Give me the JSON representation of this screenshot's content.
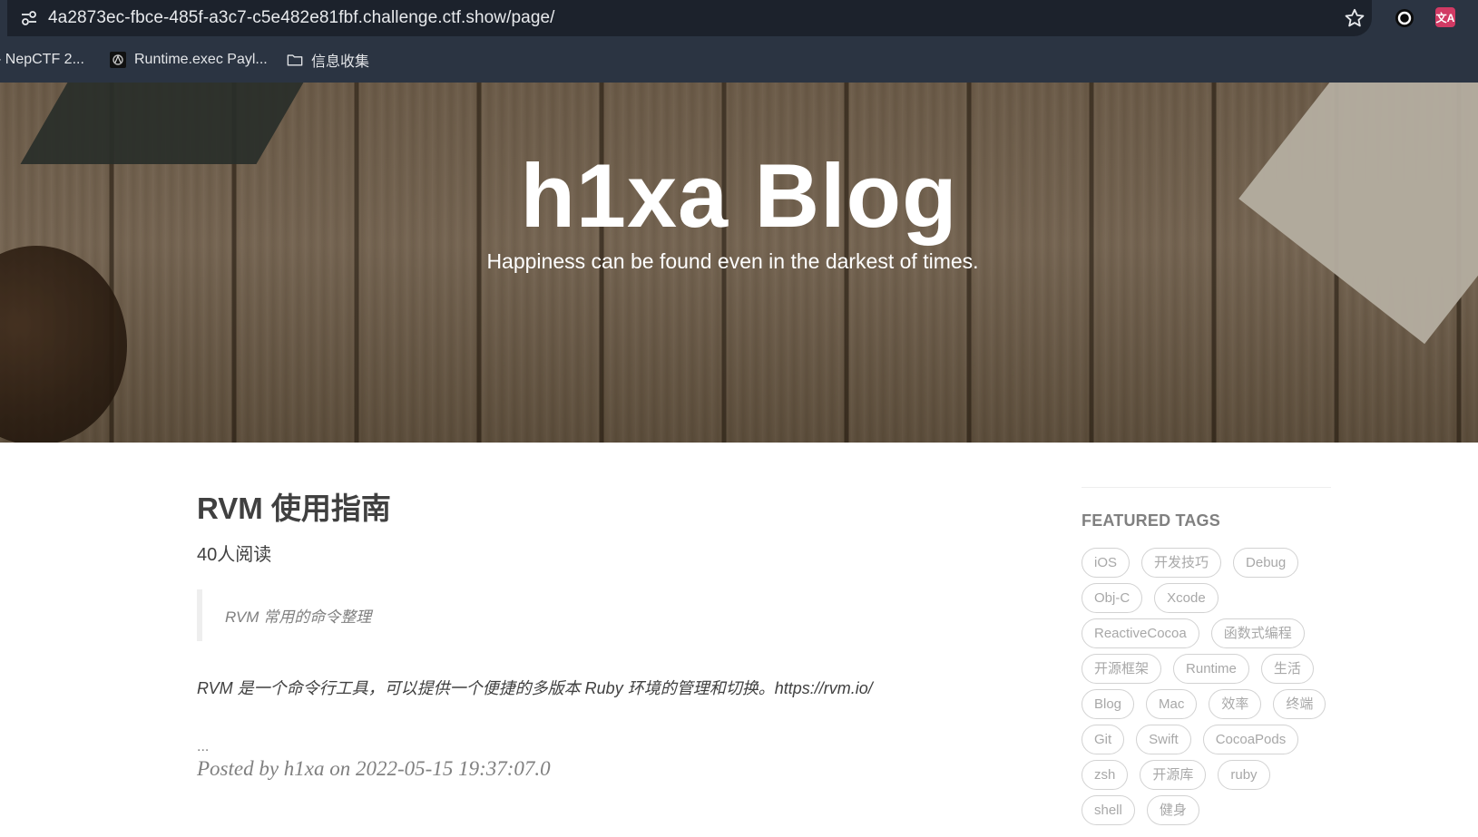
{
  "browser": {
    "url": "4a2873ec-fbce-485f-a3c7-c5e482e81fbf.challenge.ctf.show/page/",
    "icons": {
      "site_info": "tune-icon",
      "bookmark": "star-icon",
      "extension": "circle-icon",
      "translate": "translate-icon"
    },
    "translate_glyph": "文A",
    "bookmarks": [
      {
        "label": "- NepCTF 2...",
        "icon": "page-icon"
      },
      {
        "label": "Runtime.exec Payl...",
        "icon": "site-favicon"
      },
      {
        "label": "信息收集",
        "icon": "folder-icon"
      }
    ]
  },
  "hero": {
    "title": "h1xa Blog",
    "subtitle": "Happiness can be found even in the darkest of times."
  },
  "post": {
    "title": "RVM 使用指南",
    "reads": "40人阅读",
    "quote": "RVM 常用的命令整理",
    "body": "RVM 是一个命令行工具，可以提供一个便捷的多版本 Ruby 环境的管理和切换。https://rvm.io/",
    "ellipsis": "...",
    "meta": "Posted by h1xa on 2022-05-15 19:37:07.0"
  },
  "sidebar": {
    "heading": "FEATURED TAGS",
    "tags": [
      "iOS",
      "开发技巧",
      "Debug",
      "Obj-C",
      "Xcode",
      "ReactiveCocoa",
      "函数式编程",
      "开源框架",
      "Runtime",
      "生活",
      "Blog",
      "Mac",
      "效率",
      "终端",
      "Git",
      "Swift",
      "CocoaPods",
      "zsh",
      "开源库",
      "ruby",
      "shell",
      "健身"
    ]
  },
  "colors": {
    "chrome_bg": "#2b3442",
    "urlbar_bg": "#1c222c",
    "text_dark": "#404040",
    "text_muted": "#808080",
    "tag_border": "#d2d2d2",
    "translate_accent": "#d13a64"
  }
}
